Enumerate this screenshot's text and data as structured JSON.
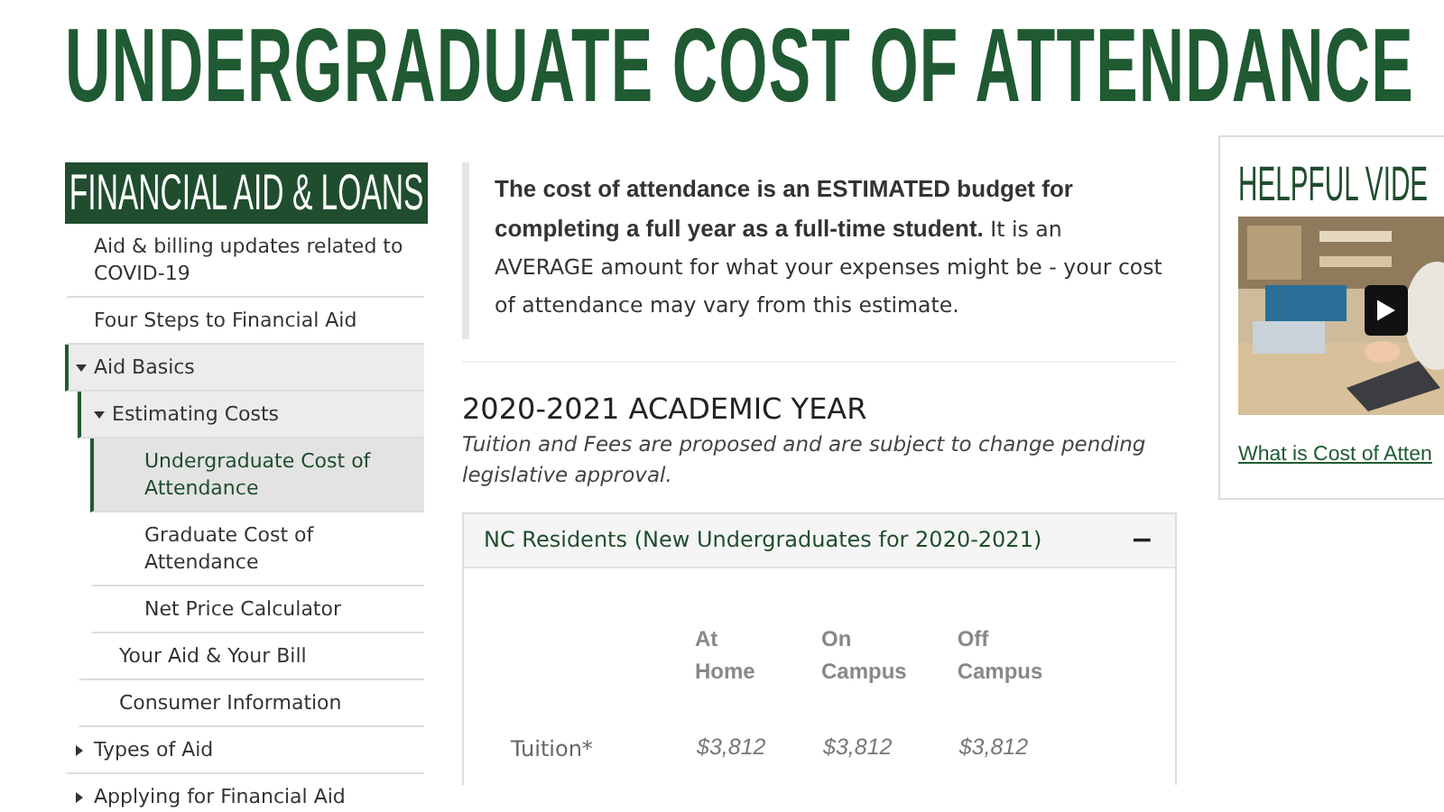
{
  "page_title": "UNDERGRADUATE COST OF ATTENDANCE",
  "sidebar": {
    "heading": "FINANCIAL AID & LOANS",
    "items": [
      {
        "label": "Aid & billing updates related to COVID-19",
        "kind": "link",
        "selected": false
      },
      {
        "label": "Four Steps to Financial Aid",
        "kind": "link",
        "selected": false
      },
      {
        "label": "Aid Basics",
        "kind": "folder",
        "expanded": true,
        "selected": false,
        "children": [
          {
            "label": "Estimating Costs",
            "kind": "folder",
            "expanded": true,
            "selected": false,
            "children": [
              {
                "label": "Undergraduate Cost of Attendance",
                "kind": "link",
                "selected": true
              },
              {
                "label": "Graduate Cost of Attendance",
                "kind": "link",
                "selected": false
              },
              {
                "label": "Net Price Calculator",
                "kind": "link",
                "selected": false
              }
            ]
          },
          {
            "label": "Your Aid & Your Bill",
            "kind": "link",
            "selected": false
          },
          {
            "label": "Consumer Information",
            "kind": "link",
            "selected": false
          }
        ]
      },
      {
        "label": "Types of Aid",
        "kind": "folder",
        "expanded": false,
        "selected": false
      },
      {
        "label": "Applying for Financial Aid",
        "kind": "folder",
        "expanded": false,
        "selected": false
      }
    ]
  },
  "intro": "**The cost of attendance is an ESTIMATED budget for completing a full year as a full-time student.** It is an AVERAGE amount for what your expenses might be - your cost of attendance may vary from this estimate.",
  "section": {
    "heading": "2020-2021 ACADEMIC YEAR",
    "note": "Tuition and Fees are proposed and are subject to change pending legislative approval."
  },
  "accordion": {
    "title": "NC Residents (New Undergraduates for 2020-2021)",
    "toggle": "−",
    "expanded": true,
    "table": {
      "columns": [
        "At Home",
        "On Campus",
        "Off Campus"
      ],
      "rows": [
        {
          "label": "Tuition*",
          "values": [
            "$3,812",
            "$3,812",
            "$3,812"
          ]
        }
      ]
    }
  },
  "video_box": {
    "heading": "HELPFUL VIDE",
    "link": "What is Cost of Atten"
  }
}
